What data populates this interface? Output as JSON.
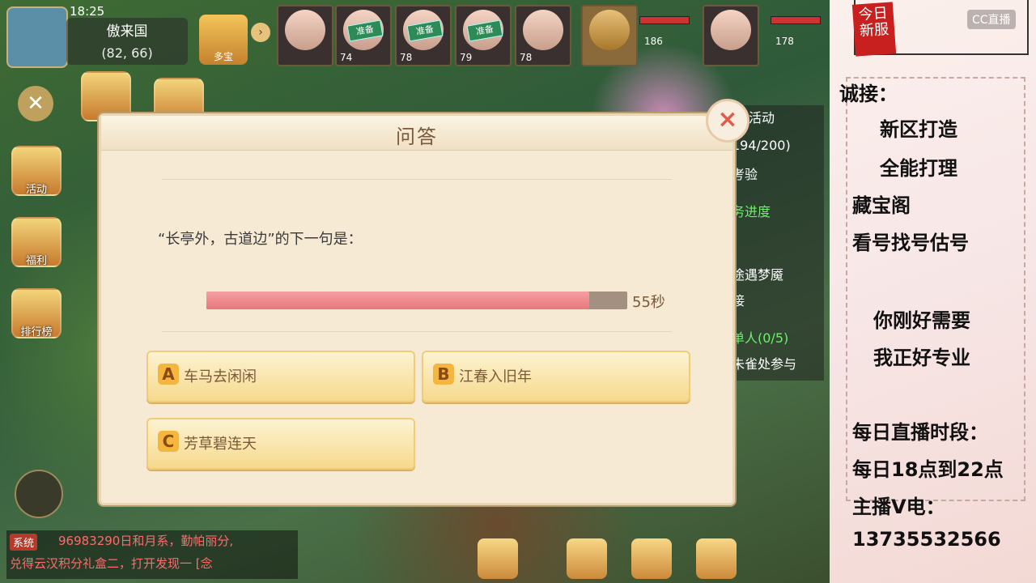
{
  "game": {
    "clock": "18:25",
    "location_name": "傲来国",
    "location_coord": "(82, 66)",
    "map_button_label": "多宝",
    "team": [
      {
        "level": "",
        "tag": ""
      },
      {
        "level": "74",
        "tag": "准备"
      },
      {
        "level": "78",
        "tag": "准备"
      },
      {
        "level": "79",
        "tag": "准备"
      },
      {
        "level": "78",
        "tag": ""
      },
      {
        "level": "",
        "tag": ""
      }
    ],
    "hp_left": "186",
    "hp_right": "178",
    "side_icons": [
      {
        "label": "活动"
      },
      {
        "label": "福利"
      },
      {
        "label": "排行榜"
      }
    ],
    "right_panel": {
      "tab": "活动",
      "progress": "194/200)",
      "line2": "考验",
      "line3": "务进度",
      "line4": "途遇梦魇",
      "line5": "接",
      "line6": "单人(0/5)",
      "line7": "朱雀处参与"
    },
    "chat": {
      "system_tag": "系统",
      "line1": "96983290日和月系，勤帕丽分,",
      "line2": "兑得云汉积分礼盒二，打开发现一 [念"
    }
  },
  "quiz": {
    "title": "问答",
    "question": "“长亭外，古道边”的下一句是：",
    "timer_fraction": 0.91,
    "timer_text": "55秒",
    "options": [
      {
        "letter": "A",
        "text": "车马去闲闲"
      },
      {
        "letter": "B",
        "text": "江春入旧年"
      },
      {
        "letter": "C",
        "text": "芳草碧连天"
      }
    ],
    "close_label": "×"
  },
  "stream": {
    "logo_text": "今日新服",
    "cc_label": "CC直播",
    "lines": [
      "诚接：",
      "新区打造",
      "全能打理",
      "藏宝阁",
      "看号找号估号",
      "你刚好需要",
      "我正好专业",
      "每日直播时段：",
      "每日18点到22点",
      "主播V电：",
      "13735532566"
    ]
  }
}
